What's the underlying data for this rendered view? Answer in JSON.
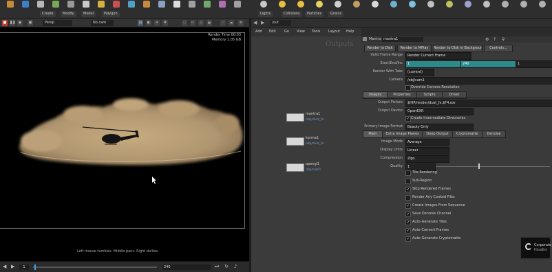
{
  "colors": {
    "accent": "#2e8a8a",
    "dust": "#b49a74",
    "link": "#6fa4d8"
  },
  "shelf": {
    "tabs": [
      "Create",
      "Modify",
      "Model",
      "Polygon"
    ],
    "tools": [
      {
        "label": "Box",
        "icon": "box-icon",
        "color": "#c58b3a"
      },
      {
        "label": "Sphere",
        "icon": "sphere-icon",
        "color": "#3d7fc8"
      },
      {
        "label": "Tube",
        "icon": "tube-icon",
        "color": "#b8b8b8"
      },
      {
        "label": "Torus",
        "icon": "torus-icon",
        "color": "#7aa85a"
      },
      {
        "label": "Grid",
        "icon": "grid-icon",
        "color": "#9a9a9a"
      },
      {
        "label": "Null",
        "icon": "null-icon",
        "color": "#c8c8c8"
      },
      {
        "label": "Line",
        "icon": "line-icon",
        "color": "#d4b040"
      },
      {
        "label": "Circle",
        "icon": "circle-icon",
        "color": "#c85050"
      },
      {
        "label": "Curve",
        "icon": "curve-icon",
        "color": "#50a0c8"
      },
      {
        "label": "Path",
        "icon": "path-icon",
        "color": "#c88a40"
      },
      {
        "label": "Spray",
        "icon": "spray-icon",
        "color": "#8aa0c0"
      },
      {
        "label": "Font",
        "icon": "font-icon",
        "color": "#dcdcdc"
      },
      {
        "label": "Platonic",
        "icon": "platonic-icon",
        "color": "#a0a0a0"
      },
      {
        "label": "L-System",
        "icon": "lsystem-icon",
        "color": "#70a870"
      },
      {
        "label": "Metaball",
        "icon": "metaball-icon",
        "color": "#b070b0"
      },
      {
        "label": "File",
        "icon": "file-icon",
        "color": "#a0a0a0"
      }
    ],
    "right_tabs": [
      "Lights",
      "Collisions",
      "Particles",
      "Grains"
    ],
    "right_tools": [
      {
        "label": "Camera",
        "icon": "camera-icon",
        "color": "#c8c8c8"
      },
      {
        "label": "Point Light",
        "icon": "point-light-icon",
        "color": "#e8c040"
      },
      {
        "label": "Spot Light",
        "icon": "spot-light-icon",
        "color": "#e8c040"
      },
      {
        "label": "Area Light",
        "icon": "area-light-icon",
        "color": "#e8d060"
      },
      {
        "label": "Geo Light",
        "icon": "geo-light-icon",
        "color": "#d0d0d0"
      },
      {
        "label": "Volume Light",
        "icon": "volume-light-icon",
        "color": "#c0a060"
      },
      {
        "label": "Distant",
        "icon": "distant-light-icon",
        "color": "#d8d8d8"
      },
      {
        "label": "Env Light",
        "icon": "env-light-icon",
        "color": "#70b0d0"
      },
      {
        "label": "Sky Light",
        "icon": "sky-light-icon",
        "color": "#80c0e0"
      },
      {
        "label": "GI Light",
        "icon": "gi-light-icon",
        "color": "#c0c0c0"
      },
      {
        "label": "Caustic",
        "icon": "caustic-icon",
        "color": "#c0c060"
      },
      {
        "label": "Portal",
        "icon": "portal-icon",
        "color": "#a0a0d0"
      },
      {
        "label": "Ambient",
        "icon": "ambient-icon",
        "color": "#c0c0c0"
      },
      {
        "label": "Stereo",
        "icon": "stereo-icon",
        "color": "#b0b0b0"
      },
      {
        "label": "VR Cam",
        "icon": "vr-camera-icon",
        "color": "#b0b0b0"
      },
      {
        "label": "Switcher",
        "icon": "switcher-icon",
        "color": "#b0b0b0"
      }
    ]
  },
  "viewport": {
    "toolbar": {
      "view": "Persp",
      "camera": "No cam"
    },
    "hud": {
      "line1": "Render Time 00:03",
      "line2": "Memory 1.05 GB"
    },
    "footer": "Left mouse tumbles. Middle pans. Right dollies."
  },
  "timeline": {
    "frame": "1",
    "end_frame": "240"
  },
  "network": {
    "menu": [
      "Add",
      "Edit",
      "Go",
      "View",
      "Tools",
      "Layout",
      "Help"
    ],
    "path": "/out",
    "title": "Outputs",
    "nodes": [
      {
        "name": "mantra1",
        "path": "/obj/dust_fx"
      },
      {
        "name": "karma1",
        "path": "/obj/dust_fx"
      },
      {
        "name": "opengl1",
        "path": "/obj/cam1"
      }
    ]
  },
  "params": {
    "header": {
      "type": "Mantra",
      "name": "mantra1"
    },
    "top_buttons": [
      "Render to Disk",
      "Render to MPlay",
      "Render to Disk in Background",
      "Controls..."
    ],
    "valid_frame_range_label": "Valid Frame Range",
    "valid_frame_range": "Render Current Frame",
    "start_end_label": "Start/End/Inc",
    "start": "1",
    "end": "240",
    "inc": "1",
    "render_with_take_label": "Render With Take",
    "render_with_take": "(current)",
    "camera_label": "Camera",
    "camera": "/obj/cam1",
    "override_camera": "Override Camera Resolution",
    "main_tabs": [
      "Images",
      "Properties",
      "Scripts",
      "Driver"
    ],
    "output_picture_label": "Output Picture",
    "output_picture": "$HIP/render/dust_fx.$F4.exr",
    "output_device_label": "Output Device",
    "output_device": "OpenEXR",
    "create_dirs": "Create Intermediate Directories",
    "primary_image_label": "Primary Image Format",
    "primary_image": "Beauty Only",
    "sub_tabs": [
      "Main",
      "Extra Image Planes",
      "Deep Output",
      "Cryptomatte",
      "Denoise"
    ],
    "image_mode_label": "Image Mode",
    "image_mode": "Average",
    "display_units_label": "Display Units",
    "display_units": "Linear",
    "compression_label": "Compression",
    "compression": "Zips",
    "quality_label": "Quality",
    "quality": "1",
    "checks": [
      {
        "label": "Tile Rendering",
        "on": false
      },
      {
        "label": "Sub-Region",
        "on": false
      },
      {
        "label": "Skip Rendered Frames",
        "on": true
      },
      {
        "label": "Render Any Cooked Files",
        "on": false
      },
      {
        "label": "Create Images From Sequence",
        "on": true
      },
      {
        "label": "Save Denoise Channel",
        "on": true
      },
      {
        "label": "Auto-Generate Tiles",
        "on": true
      },
      {
        "label": "Auto-Convert Frames",
        "on": true
      },
      {
        "label": "Auto-Generate Cryptomatte",
        "on": true
      }
    ]
  },
  "watermark": {
    "line1": "Corporate",
    "line2": "Houdini"
  }
}
